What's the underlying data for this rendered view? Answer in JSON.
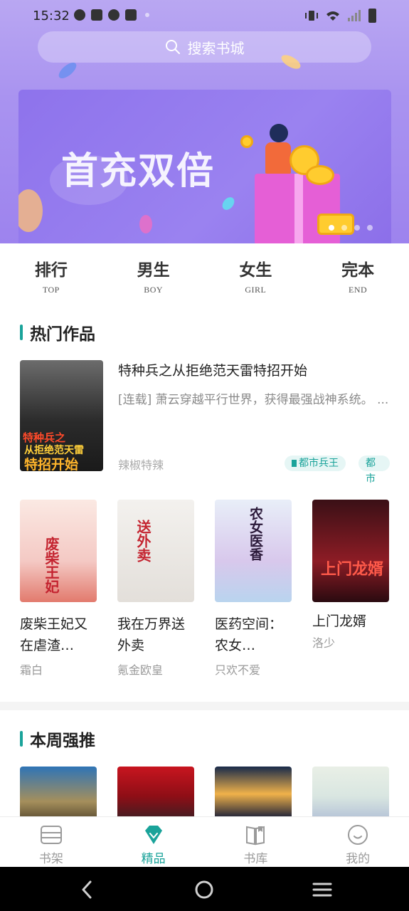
{
  "status_bar": {
    "time": "15:32"
  },
  "search": {
    "placeholder": "搜索书城"
  },
  "banner": {
    "headline": "首充双倍",
    "page_count": 4,
    "active_page": 1
  },
  "categories": [
    {
      "label": "排行",
      "sub": "TOP"
    },
    {
      "label": "男生",
      "sub": "BOY"
    },
    {
      "label": "女生",
      "sub": "GIRL"
    },
    {
      "label": "完本",
      "sub": "END"
    }
  ],
  "hot_section": {
    "title": "热门作品"
  },
  "featured": {
    "title": "特种兵之从拒绝范天雷特招开始",
    "description": "[连载] 萧云穿越平行世界，获得最强战神系统。 ...",
    "author": "辣椒特辣",
    "tags": [
      "都市兵王",
      "都市"
    ],
    "cover_text_1": "特种兵之",
    "cover_text_2": "从拒绝范天雷",
    "cover_text_3": "特招开始"
  },
  "books": [
    {
      "title": "废柴王妃又在虐渣…",
      "author": "霜白",
      "cover_text": "废柴王妃"
    },
    {
      "title": "我在万界送外卖",
      "author": "氪金欧皇",
      "cover_text": "送外卖"
    },
    {
      "title": "医药空间：农女…",
      "author": "只欢不爱",
      "cover_text": "农女医香"
    },
    {
      "title": "上门龙婿",
      "author": "洛少",
      "cover_text": "上门龙婿"
    }
  ],
  "weekly_section": {
    "title": "本周强推"
  },
  "tabs": [
    {
      "label": "书架",
      "icon": "bookshelf-icon",
      "active": false
    },
    {
      "label": "精品",
      "icon": "diamond-icon",
      "active": true
    },
    {
      "label": "书库",
      "icon": "library-icon",
      "active": false
    },
    {
      "label": "我的",
      "icon": "smile-icon",
      "active": false
    }
  ],
  "colors": {
    "accent": "#1aa39a",
    "header": "#a993f0"
  }
}
